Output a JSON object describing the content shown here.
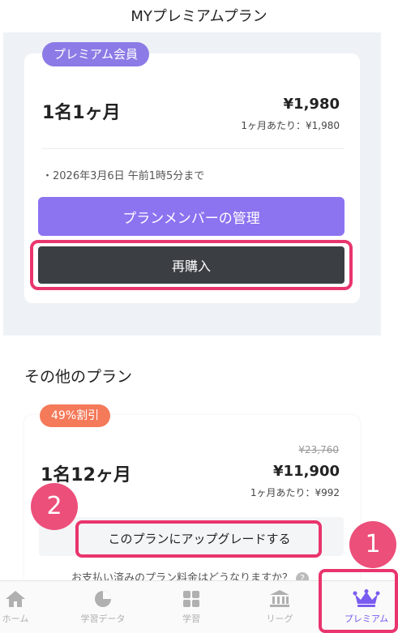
{
  "header": {
    "title": "MYプレミアムプラン"
  },
  "my_plan": {
    "badge": "プレミアム会員",
    "name": "1名1ヶ月",
    "price": "¥1,980",
    "per_month": "1ヶ月あたり：¥1,980",
    "expiry": "・2026年3月6日 午前1時5分まで",
    "manage_button": "プランメンバーの管理",
    "rebuy_button": "再購入"
  },
  "other_plans": {
    "title": "その他のプラン",
    "plans": [
      {
        "badge": "49%割引",
        "name": "1名12ヶ月",
        "old_price": "¥23,760",
        "price": "¥11,900",
        "per_month": "1ヶ月あたり：¥992",
        "upgrade_button": "このプランにアップグレードする",
        "faq": "お支払い済みのプラン料金はどうなりますか？"
      }
    ]
  },
  "annotations": {
    "step1": "1",
    "step2": "2"
  },
  "tabbar": {
    "items": [
      {
        "label": "ホーム",
        "icon": "home-icon"
      },
      {
        "label": "学習データ",
        "icon": "pie-chart-icon"
      },
      {
        "label": "学習",
        "icon": "grid-icon"
      },
      {
        "label": "リーグ",
        "icon": "bank-icon"
      },
      {
        "label": "プレミアム",
        "icon": "crown-icon"
      }
    ]
  },
  "colors": {
    "accent": "#8c73f0",
    "highlight": "#e9356d",
    "step_circle": "#ec4f7a",
    "discount_badge": "#f47a5a",
    "premium_badge": "#8c7be6",
    "rebuy_button": "#3b3f44"
  }
}
